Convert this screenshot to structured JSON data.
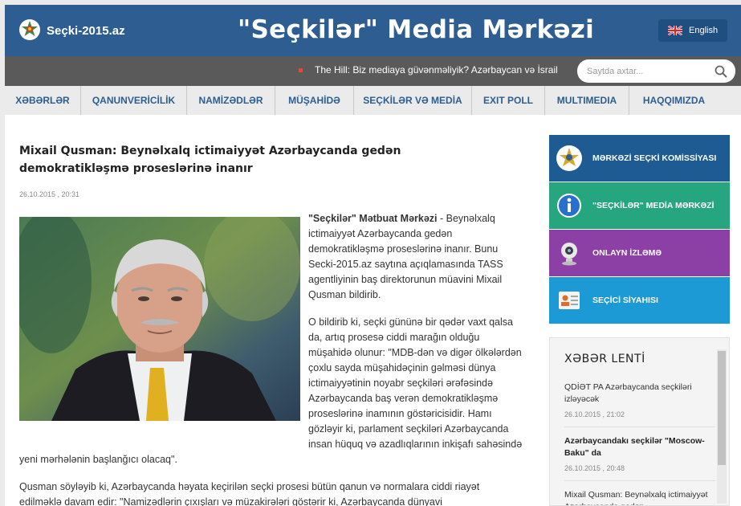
{
  "header": {
    "site_name": "Seçki-2015.az",
    "title": "\"Seçkilər\" Media Mərkəzi",
    "language_label": "English"
  },
  "ticker": {
    "text": "The Hill: Biz mediaya güvənməliyik? Azərbaycan və İsrail"
  },
  "search": {
    "placeholder": "Saytda axtar..."
  },
  "nav": {
    "items": [
      {
        "label": "XƏBƏRLƏR"
      },
      {
        "label": "QANUNVERİCİLİK"
      },
      {
        "label": "NAMİZƏDLƏR"
      },
      {
        "label": "MÜŞAHİDƏ"
      },
      {
        "label": "SEÇKİLƏR VƏ MEDİA"
      },
      {
        "label": "EXIT POLL"
      },
      {
        "label": "MULTIMEDIA"
      },
      {
        "label": "HAQQIMIZDA"
      }
    ]
  },
  "article": {
    "title": "Mixail Qusman: Beynəlxalq ictimaiyyət Azərbaycanda gedən demokratikləşmə proseslərinə inanır",
    "date": "26.10.2015 , 20:31",
    "lead_source": "\"Seçkilər\" Mətbuat Mərkəzi",
    "lead_text": " - Beynəlxalq ictimaiyyət Azərbaycanda  gedən demokratikləşmə proseslərinə inanır. Bunu Secki-2015.az saytına açıqlamasında TASS agentliyinin baş direktorunun müavini Mixail Qusman bildirib.",
    "paragraph_2": "O bildirib ki, seçki gününə bir qədər vaxt qalsa da, artıq prosesə ciddi marağın olduğu müşahidə olunur: \"MDB-dən və digər ölkələrdən çoxlu sayda müşahidəçinin gəlməsi dünya ictimaiyyətinin noyabr seçkiləri ərəfəsində Azərbaycanda baş verən demokratikləşmə proseslərinə inamının göstəricisidir. Hamı gözləyir ki, parlament seçkiləri Azərbaycanda insan hüquq və azadlıqlarının inkişafı sahəsində yeni mərhələnin başlanğıcı olacaq\".",
    "paragraph_3": "Qusman söyləyib ki, Azərbaycanda həyata keçirilən seçki prosesi bütün qanun və normalara ciddi riayət edilməklə davam edir: \"Namizədlərin çıxışları və müzakirələri göstərir ki, Azərbaycanda dünyavi"
  },
  "sidebar": {
    "banners": [
      {
        "label": "MƏRKƏZİ SEÇKİ KOMİSSİYASI",
        "icon": "mssk-emblem-icon",
        "color": "#1d5b92"
      },
      {
        "label": "\"SEÇKİLƏR\" MEDİA MƏRKƏZİ",
        "icon": "info-icon",
        "color": "#25a67e"
      },
      {
        "label": "ONLAYN İZLƏMƏ",
        "icon": "webcam-icon",
        "color": "#8c3fa4"
      },
      {
        "label": "SEÇİCİ SİYAHISI",
        "icon": "voter-list-icon",
        "color": "#1c9ad6"
      }
    ],
    "news_feed": {
      "title": "XƏBƏR LENTİ",
      "items": [
        {
          "headline": "QDİƏT PA Azərbaycanda seçkiləri izləyəcək",
          "date": "26.10.2015 , 21:02",
          "bold": false
        },
        {
          "headline": "Azərbaycandakı seçkilər \"Moscow-Baku\" da",
          "date": "26.10.2015 , 20:48",
          "bold": true
        },
        {
          "headline": "Mixail Qusman: Beynəlxalq ictimaiyyət Azərbaycanda gedən",
          "date": "",
          "bold": false
        }
      ]
    }
  },
  "colors": {
    "header_blue": "#2d5d91",
    "ticker_gray": "#5a5a5a",
    "nav_text": "#2d5d91"
  }
}
